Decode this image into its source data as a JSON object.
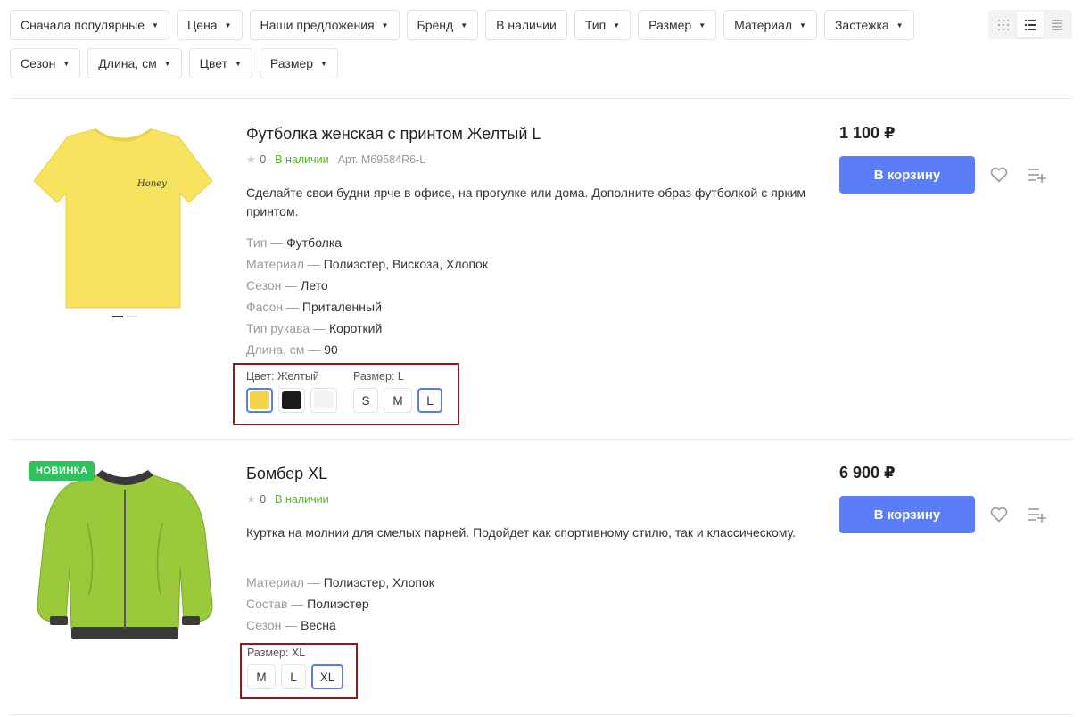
{
  "filters": {
    "row1": [
      {
        "label": "Сначала популярные"
      },
      {
        "label": "Цена"
      },
      {
        "label": "Наши предложения"
      },
      {
        "label": "Бренд"
      },
      {
        "label": "В наличии"
      },
      {
        "label": "Тип"
      },
      {
        "label": "Размер"
      },
      {
        "label": "Материал"
      },
      {
        "label": "Застежка"
      }
    ],
    "row2": [
      {
        "label": "Сезон"
      },
      {
        "label": "Длина, см"
      },
      {
        "label": "Цвет"
      },
      {
        "label": "Размер"
      }
    ]
  },
  "view_switch": {
    "icons": [
      "grid-view-icon",
      "list-view-icon",
      "compact-list-icon"
    ],
    "active": "list-view-icon"
  },
  "products": [
    {
      "title": "Футболка женская с принтом Желтый L",
      "rating": "0",
      "stock": "В наличии",
      "sku": "Арт. M69584R6-L",
      "description": "Сделайте свои будни ярче в офисе, на прогулке или дома. Дополните образ футболкой с ярким принтом.",
      "props": [
        {
          "name": "Тип",
          "value": "Футболка"
        },
        {
          "name": "Материал",
          "value": "Полиэстер, Вискоза, Хлопок"
        },
        {
          "name": "Сезон",
          "value": "Лето"
        },
        {
          "name": "Фасон",
          "value": "Приталенный"
        },
        {
          "name": "Тип рукава",
          "value": "Короткий"
        },
        {
          "name": "Длина, см",
          "value": "90"
        }
      ],
      "color_label": "Цвет: Желтый",
      "colors": [
        "#f2d34a",
        "#1a1a1a",
        "#f3f3f3"
      ],
      "size_label": "Размер: L",
      "sizes": [
        "S",
        "M",
        "L"
      ],
      "selected_size": "L",
      "price": "1 100 ₽",
      "cart_label": "В корзину",
      "print_text": "Honey"
    },
    {
      "badge": "НОВИНКА",
      "title": "Бомбер XL",
      "rating": "0",
      "stock": "В наличии",
      "description": "Куртка на молнии для смелых парней. Подойдет как спортивному стилю, так и классическому.",
      "props": [
        {
          "name": "Материал",
          "value": "Полиэстер, Хлопок"
        },
        {
          "name": "Состав",
          "value": "Полиэстер"
        },
        {
          "name": "Сезон",
          "value": "Весна"
        }
      ],
      "size_label": "Размер: XL",
      "sizes": [
        "M",
        "L",
        "XL"
      ],
      "selected_size": "XL",
      "price": "6 900 ₽",
      "cart_label": "В корзину"
    }
  ],
  "colors": {
    "accent": "#5b7ef8",
    "stock": "#52b71f",
    "badge": "#2dc25b",
    "highlight": "#8b1a1a"
  }
}
